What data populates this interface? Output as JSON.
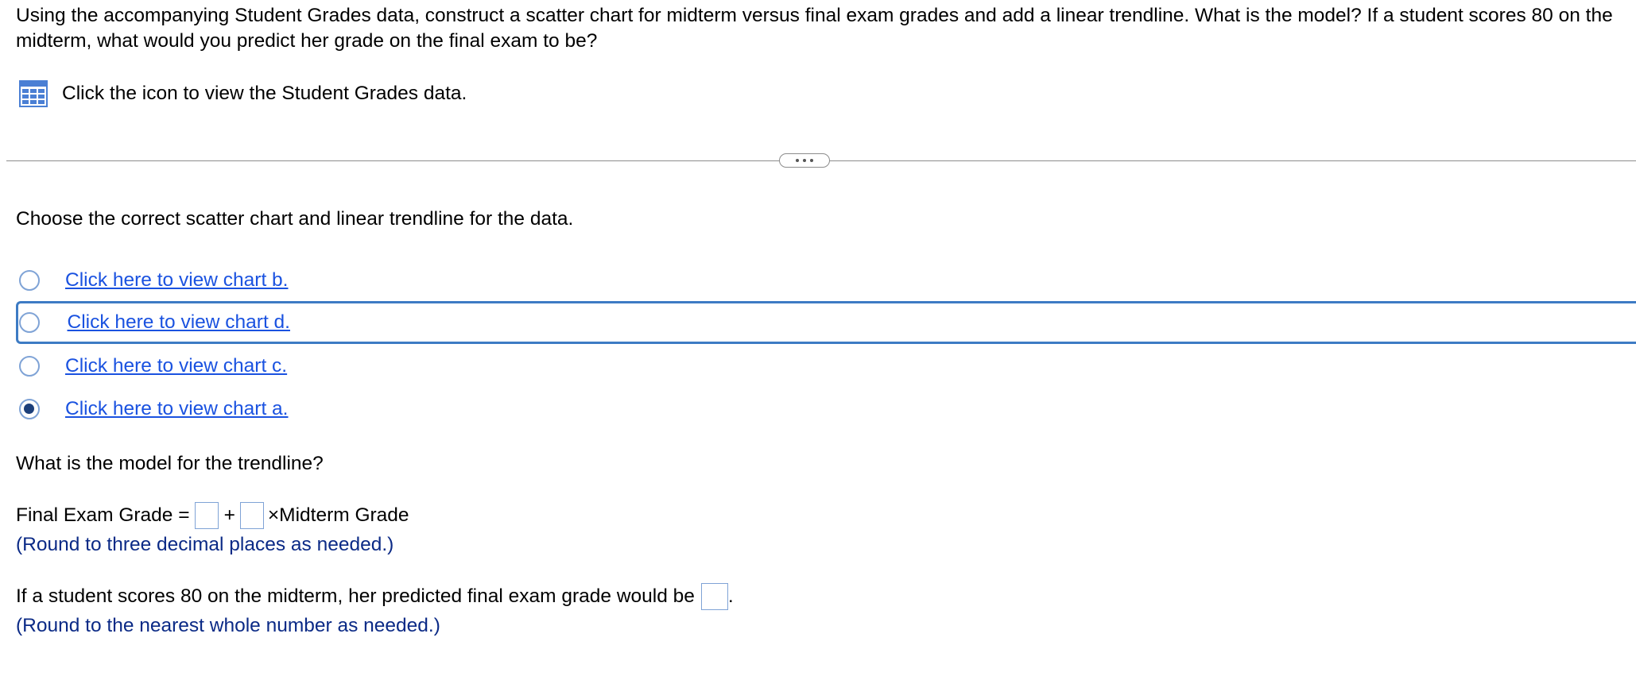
{
  "question": {
    "text": "Using the accompanying Student Grades data, construct a scatter chart for midterm versus final exam grades and add a linear trendline. What is the model? If a student scores 80 on the midterm, what would you predict her grade on the final exam to be?"
  },
  "data_link": {
    "icon": "table-grid-icon",
    "text": "Click the icon to view the Student Grades data."
  },
  "divider": {
    "button_label": "..."
  },
  "chart_choice": {
    "prompt": "Choose the correct scatter chart and linear trendline for the data.",
    "options": [
      {
        "label": "Click here to view chart b.",
        "selected": false,
        "focused": false
      },
      {
        "label": "Click here to view chart d.",
        "selected": false,
        "focused": true
      },
      {
        "label": "Click here to view chart c.",
        "selected": false,
        "focused": false
      },
      {
        "label": "Click here to view chart a.",
        "selected": true,
        "focused": false
      }
    ]
  },
  "model": {
    "prompt": "What is the model for the trendline?",
    "lhs": "Final Exam Grade =",
    "plus": "+",
    "times_label": "×Midterm Grade",
    "intercept_value": "",
    "slope_value": "",
    "hint": "(Round to three decimal places as needed.)"
  },
  "prediction": {
    "text": "If a student scores 80 on the midterm, her predicted final exam grade would be",
    "suffix": ".",
    "value": "",
    "hint": "(Round to the nearest whole number as needed.)"
  },
  "colors": {
    "link": "#1a52e0",
    "hint": "#0b2a86",
    "focus_border": "#3d7bc4",
    "radio_border": "#7fa3d6",
    "radio_fill": "#1c3f7a",
    "icon_blue": "#4a7fd4"
  }
}
